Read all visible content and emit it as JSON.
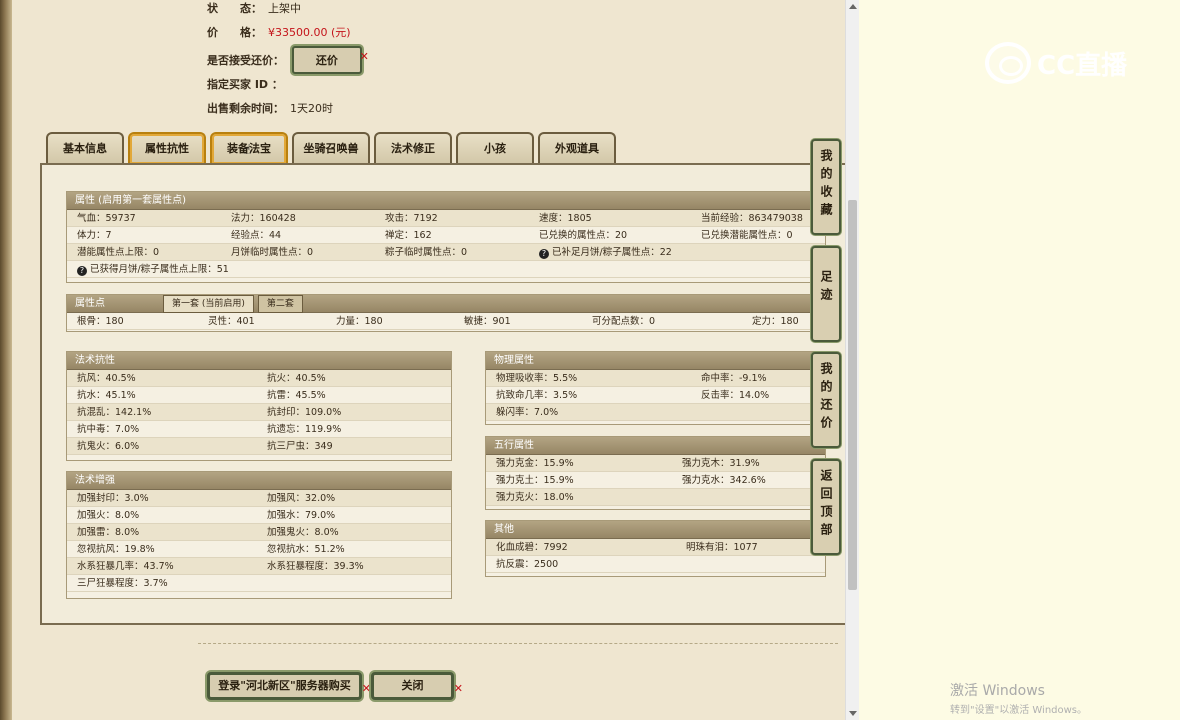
{
  "top_info": {
    "status_label": "状　　态：",
    "status_value": "上架中",
    "price_label": "价　　格：",
    "price_value": "¥33500.00 (元)",
    "counter_offer_label": "是否接受还价：",
    "counter_offer_button": "还价",
    "buyer_id_label": "指定买家 ID ：",
    "remaining_label": "出售剩余时间：",
    "remaining_value": "1天20时"
  },
  "tabs": [
    "基本信息",
    "属性抗性",
    "装备法宝",
    "坐骑召唤兽",
    "法术修正",
    "小孩",
    "外观道具"
  ],
  "attributes": {
    "title": "属性 (启用第一套属性点)",
    "rows": [
      [
        "气血：59737",
        "法力：160428",
        "攻击：7192",
        "速度：1805",
        "当前经验：863479038"
      ],
      [
        "体力：7",
        "经验点：44",
        "禅定：162",
        "已兑换的属性点：20",
        "已兑换潜能属性点：0"
      ],
      [
        "潜能属性点上限：0",
        "月饼临时属性点：0",
        "粽子临时属性点：0",
        "已补足月饼/粽子属性点：22",
        ""
      ],
      [
        "已获得月饼/粽子属性点上限：51",
        "",
        "",
        "",
        ""
      ]
    ]
  },
  "points": {
    "title": "属性点",
    "subtab1": "第一套 (当前启用)",
    "subtab2": "第二套",
    "row": [
      "根骨：180",
      "灵性：401",
      "力量：180",
      "敏捷：901",
      "可分配点数：0",
      "定力：180"
    ]
  },
  "resist": {
    "title": "法术抗性",
    "rows": [
      [
        "抗风：40.5%",
        "抗火：40.5%"
      ],
      [
        "抗水：45.1%",
        "抗雷：45.5%"
      ],
      [
        "抗混乱：142.1%",
        "抗封印：109.0%"
      ],
      [
        "抗中毒：7.0%",
        "抗遗忘：119.9%"
      ],
      [
        "抗鬼火：6.0%",
        "抗三尸虫：349"
      ]
    ]
  },
  "enhance": {
    "title": "法术增强",
    "rows": [
      [
        "加强封印：3.0%",
        "加强风：32.0%"
      ],
      [
        "加强火：8.0%",
        "加强水：79.0%"
      ],
      [
        "加强雷：8.0%",
        "加强鬼火：8.0%"
      ],
      [
        "忽视抗风：19.8%",
        "忽视抗水：51.2%"
      ],
      [
        "水系狂暴几率：43.7%",
        "水系狂暴程度：39.3%"
      ],
      [
        "三尸狂暴程度：3.7%",
        ""
      ]
    ]
  },
  "physical": {
    "title": "物理属性",
    "rows": [
      [
        "物理吸收率：5.5%",
        "命中率：-9.1%"
      ],
      [
        "抗致命几率：3.5%",
        "反击率：14.0%"
      ],
      [
        "躲闪率：7.0%",
        ""
      ]
    ]
  },
  "five_elements": {
    "title": "五行属性",
    "rows": [
      [
        "强力克金：15.9%",
        "强力克木：31.9%"
      ],
      [
        "强力克土：15.9%",
        "强力克水：342.6%"
      ],
      [
        "强力克火：18.0%",
        ""
      ]
    ]
  },
  "other": {
    "title": "其他",
    "rows": [
      [
        "化血成碧：7992",
        "明珠有泪：1077"
      ],
      [
        "抗反震：2500",
        ""
      ]
    ]
  },
  "side_nav": [
    "我的收藏",
    "足迹",
    "我的还价",
    "返回顶部"
  ],
  "bottom": {
    "login_button": "登录\"河北新区\"服务器购买",
    "close_button": "关闭"
  },
  "watermark": {
    "line1": "激活 Windows",
    "line2": "转到\"设置\"以激活 Windows。"
  },
  "logo_text": "CC直播"
}
